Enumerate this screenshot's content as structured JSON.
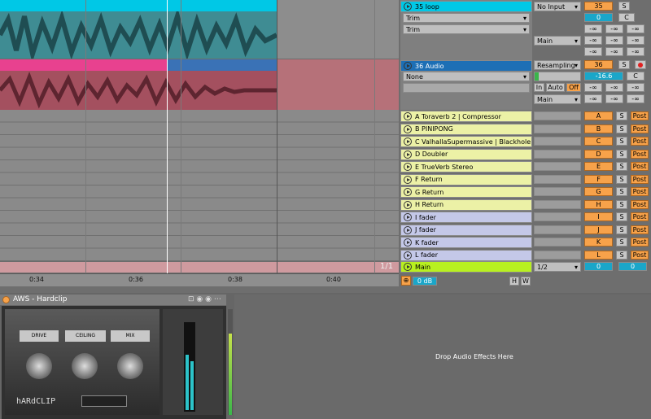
{
  "tracks": {
    "loop": {
      "name": "35 loop",
      "input": "No Input",
      "number": "35",
      "vol": "0",
      "out": "Main",
      "dd1": "Trim",
      "dd2": "Trim"
    },
    "audio": {
      "name": "36 Audio",
      "input": "Resampling",
      "number": "36",
      "vol": "-16.6",
      "pan": "C",
      "dd1": "None",
      "out": "Main",
      "mon_in": "In",
      "mon_auto": "Auto",
      "mon_off": "Off"
    },
    "loop_pan": "C",
    "inf": "-∞"
  },
  "returns": [
    {
      "name": "A Toraverb 2 | Compressor",
      "letter": "A"
    },
    {
      "name": "B PINIPONG",
      "letter": "B"
    },
    {
      "name": "C ValhallaSupermassive | Blackhole",
      "letter": "C"
    },
    {
      "name": "D Doubler",
      "letter": "D"
    },
    {
      "name": "E TrueVerb Stereo",
      "letter": "E"
    },
    {
      "name": "F Return",
      "letter": "F"
    },
    {
      "name": "G Return",
      "letter": "G"
    },
    {
      "name": "H Return",
      "letter": "H"
    },
    {
      "name": "I fader",
      "letter": "I"
    },
    {
      "name": "J fader",
      "letter": "J"
    },
    {
      "name": "K fader",
      "letter": "K"
    },
    {
      "name": "L fader",
      "letter": "L"
    }
  ],
  "labels": {
    "s": "S",
    "post": "Post"
  },
  "master": {
    "name": "Main",
    "out": "1/2",
    "vol": "0",
    "pan": "0",
    "counter": "1/1",
    "gain": "0 dB",
    "h": "H",
    "w": "W"
  },
  "ruler": [
    "0:34",
    "0:36",
    "0:38",
    "0:40"
  ],
  "device": {
    "title": "AWS - Hardclip",
    "knob1": "DRIVE",
    "knob2": "CEILING",
    "knob3": "MIX",
    "logo": "hARdCLIP",
    "drop": "Drop Audio Effects Here"
  },
  "colors": {
    "loop": "#00c8e6",
    "audio": "#e8418f",
    "returns": "#ecf1a6",
    "faders": "#c4c8e8",
    "master": "#b8f020",
    "orange": "#f7a24a"
  }
}
